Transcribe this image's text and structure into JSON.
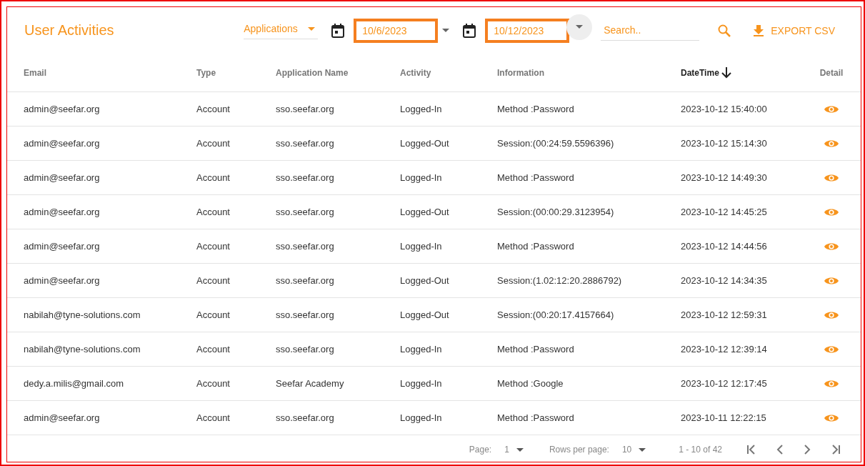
{
  "title": "User Activities",
  "filters": {
    "application": {
      "value": "Applications"
    },
    "start_date": {
      "value": "10/6/2023",
      "highlighted": true
    },
    "end_date": {
      "value": "10/12/2023",
      "highlighted": true
    },
    "search": {
      "placeholder": "Search.."
    },
    "export_button": {
      "label": "EXPORT CSV"
    }
  },
  "table": {
    "columns": [
      {
        "label": "Email",
        "sorted": false
      },
      {
        "label": "Type",
        "sorted": false
      },
      {
        "label": "Application Name",
        "sorted": false
      },
      {
        "label": "Activity",
        "sorted": false
      },
      {
        "label": "Information",
        "sorted": false
      },
      {
        "label": "DateTime",
        "sorted": true
      },
      {
        "label": "Detail",
        "sorted": false
      }
    ],
    "rows": [
      {
        "email": "admin@seefar.org",
        "type": "Account",
        "application": "sso.seefar.org",
        "activity": "Logged-In",
        "information": "Method :Password",
        "datetime": "2023-10-12 15:40:00"
      },
      {
        "email": "admin@seefar.org",
        "type": "Account",
        "application": "sso.seefar.org",
        "activity": "Logged-Out",
        "information": "Session:(00:24:59.5596396)",
        "datetime": "2023-10-12 15:14:30"
      },
      {
        "email": "admin@seefar.org",
        "type": "Account",
        "application": "sso.seefar.org",
        "activity": "Logged-In",
        "information": "Method :Password",
        "datetime": "2023-10-12 14:49:30"
      },
      {
        "email": "admin@seefar.org",
        "type": "Account",
        "application": "sso.seefar.org",
        "activity": "Logged-Out",
        "information": "Session:(00:00:29.3123954)",
        "datetime": "2023-10-12 14:45:25"
      },
      {
        "email": "admin@seefar.org",
        "type": "Account",
        "application": "sso.seefar.org",
        "activity": "Logged-In",
        "information": "Method :Password",
        "datetime": "2023-10-12 14:44:56"
      },
      {
        "email": "admin@seefar.org",
        "type": "Account",
        "application": "sso.seefar.org",
        "activity": "Logged-Out",
        "information": "Session:(1.02:12:20.2886792)",
        "datetime": "2023-10-12 14:34:35"
      },
      {
        "email": "nabilah@tyne-solutions.com",
        "type": "Account",
        "application": "sso.seefar.org",
        "activity": "Logged-Out",
        "information": "Session:(00:20:17.4157664)",
        "datetime": "2023-10-12 12:59:31"
      },
      {
        "email": "nabilah@tyne-solutions.com",
        "type": "Account",
        "application": "sso.seefar.org",
        "activity": "Logged-In",
        "information": "Method :Password",
        "datetime": "2023-10-12 12:39:14"
      },
      {
        "email": "dedy.a.milis@gmail.com",
        "type": "Account",
        "application": "Seefar Academy",
        "activity": "Logged-In",
        "information": "Method :Google",
        "datetime": "2023-10-12 12:17:45"
      },
      {
        "email": "admin@seefar.org",
        "type": "Account",
        "application": "sso.seefar.org",
        "activity": "Logged-In",
        "information": "Method :Password",
        "datetime": "2023-10-11 12:22:15"
      }
    ]
  },
  "pagination": {
    "page_label": "Page:",
    "page": "1",
    "rows_label": "Rows per page:",
    "rows_per_page": "10",
    "range": "1 - 10 of 42"
  }
}
